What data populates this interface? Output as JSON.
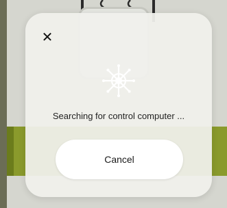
{
  "modal": {
    "close_icon": "close-icon",
    "spinner_icon": "ship-wheel-icon",
    "status_text": "Searching for control computer ...",
    "cancel_label": "Cancel"
  },
  "colors": {
    "backdrop": "#6b6d56",
    "modal_bg": "#f0f0ec",
    "accent_band": "#8a9a2c",
    "button_bg": "#ffffff",
    "text": "#1f1f1f"
  }
}
